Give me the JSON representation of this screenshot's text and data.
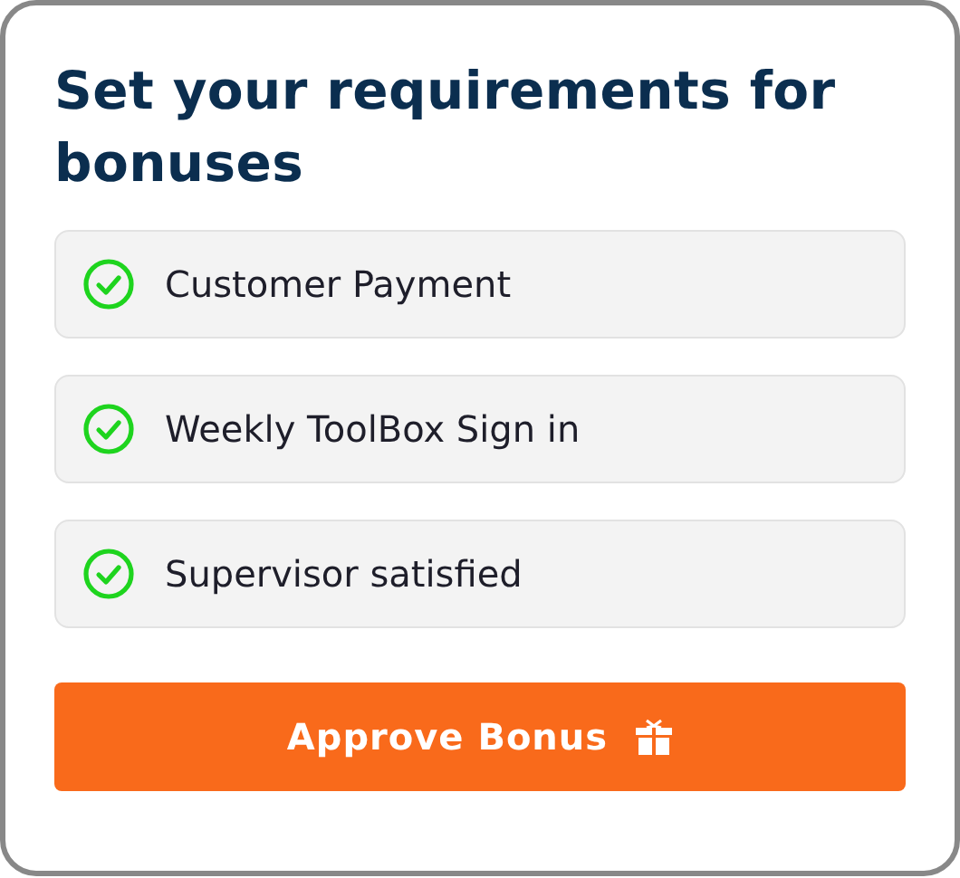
{
  "title": "Set your requirements for bonuses",
  "requirements": [
    {
      "label": "Customer Payment",
      "checked": true
    },
    {
      "label": "Weekly ToolBox Sign in",
      "checked": true
    },
    {
      "label": "Supervisor satisfied",
      "checked": true
    }
  ],
  "button": {
    "label": "Approve Bonus"
  }
}
